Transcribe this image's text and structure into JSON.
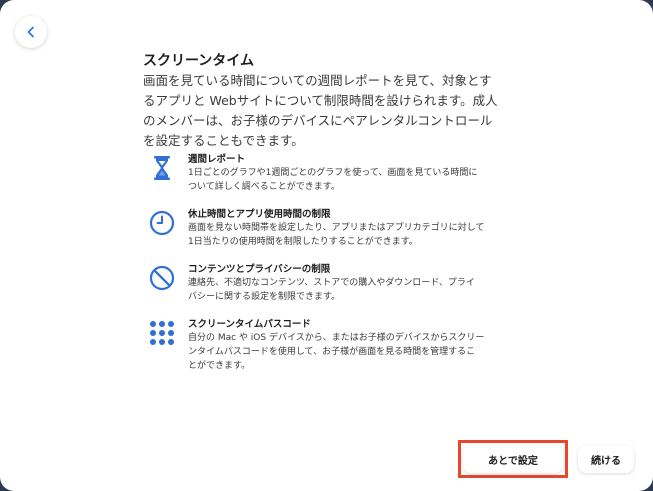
{
  "header": {
    "back_icon": "chevron-left-icon"
  },
  "title": "スクリーンタイム",
  "description_lines": [
    "画面を見ている時間についての週間レポートを見て、対象とす",
    "るアプリと Webサイトについて制限時間を設けられます。成人",
    "のメンバーは、お子様のデバイスにペアレンタルコントロール",
    "を設定することもできます。"
  ],
  "features": [
    {
      "icon": "hourglass-icon",
      "heading": "週間レポート",
      "body_lines": [
        "1日ごとのグラフや1週間ごとのグラフを使って、画面を見ている時間に",
        "ついて詳しく調べることができます。"
      ]
    },
    {
      "icon": "clock-icon",
      "heading": "休止時間とアプリ使用時間の制限",
      "body_lines": [
        "画面を見ない時間帯を設定したり、アプリまたはアプリカテゴリに対して",
        "1日当たりの使用時間を制限したりすることができます。"
      ]
    },
    {
      "icon": "prohibited-icon",
      "heading": "コンテンツとプライバシーの制限",
      "body_lines": [
        "連絡先、不適切なコンテンツ、ストアでの購入やダウンロード、プライ",
        "バシーに関する設定を制限できます。"
      ]
    },
    {
      "icon": "keypad-icon",
      "heading": "スクリーンタイムパスコード",
      "body_lines": [
        "自分の Mac や iOS デバイスから、またはお子様のデバイスからスクリー",
        "ンタイムパスコードを使用して、お子様が画面を見る時間を管理するこ",
        "とができます。"
      ]
    }
  ],
  "footer": {
    "later_label": "あとで設定",
    "continue_label": "続ける"
  },
  "colors": {
    "accent": "#2f6fd6",
    "highlight": "#e5482a",
    "background": "#2c3a4f"
  }
}
